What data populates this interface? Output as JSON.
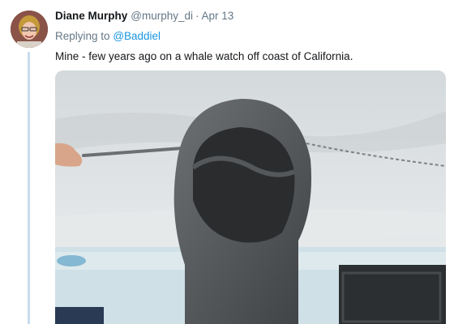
{
  "tweet": {
    "author_name": "Diane Murphy",
    "author_handle": "@murphy_di",
    "separator": "·",
    "date": "Apr 13",
    "replying_prefix": "Replying to",
    "replying_mention": "@Baddiel",
    "text": "Mine - few years ago on a whale watch off coast of California."
  },
  "colors": {
    "link": "#1b95e0",
    "thread_line": "#c8dcef",
    "secondary_text": "#657786"
  },
  "media": {
    "description_icon": "photo"
  }
}
